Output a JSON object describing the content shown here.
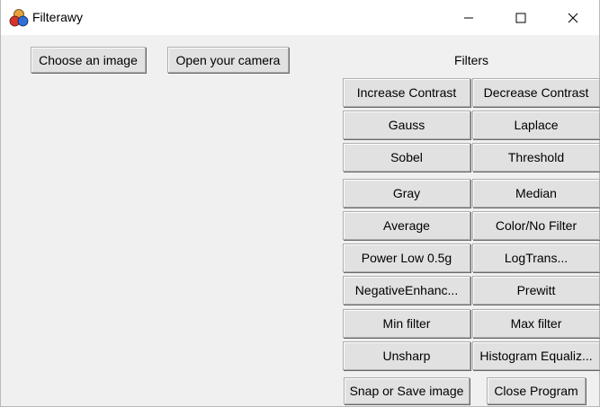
{
  "window": {
    "title": "Filterawy",
    "icon": "filterawy-app-icon",
    "controls": {
      "minimize": "minimize-icon",
      "maximize": "maximize-icon",
      "close": "close-icon"
    }
  },
  "actions": {
    "choose_image": "Choose an image",
    "open_camera": "Open your camera",
    "snap_save": "Snap or Save image",
    "close_program": "Close Program"
  },
  "filters": {
    "heading": "Filters",
    "buttons": [
      "Increase Contrast",
      "Decrease Contrast",
      "Gauss",
      "Laplace",
      "Sobel",
      "Threshold",
      "Gray",
      "Median",
      "Average",
      "Color/No Filter",
      "Power Low 0.5g",
      "LogTrans...",
      "NegativeEnhanc...",
      "Prewitt",
      "Min filter",
      "Max filter",
      "Unsharp",
      "Histogram Equaliz..."
    ]
  },
  "colors": {
    "window_bg": "#f0f0f0",
    "titlebar_bg": "#ffffff",
    "button_bg": "#e1e1e1",
    "button_border": "#adadad"
  }
}
